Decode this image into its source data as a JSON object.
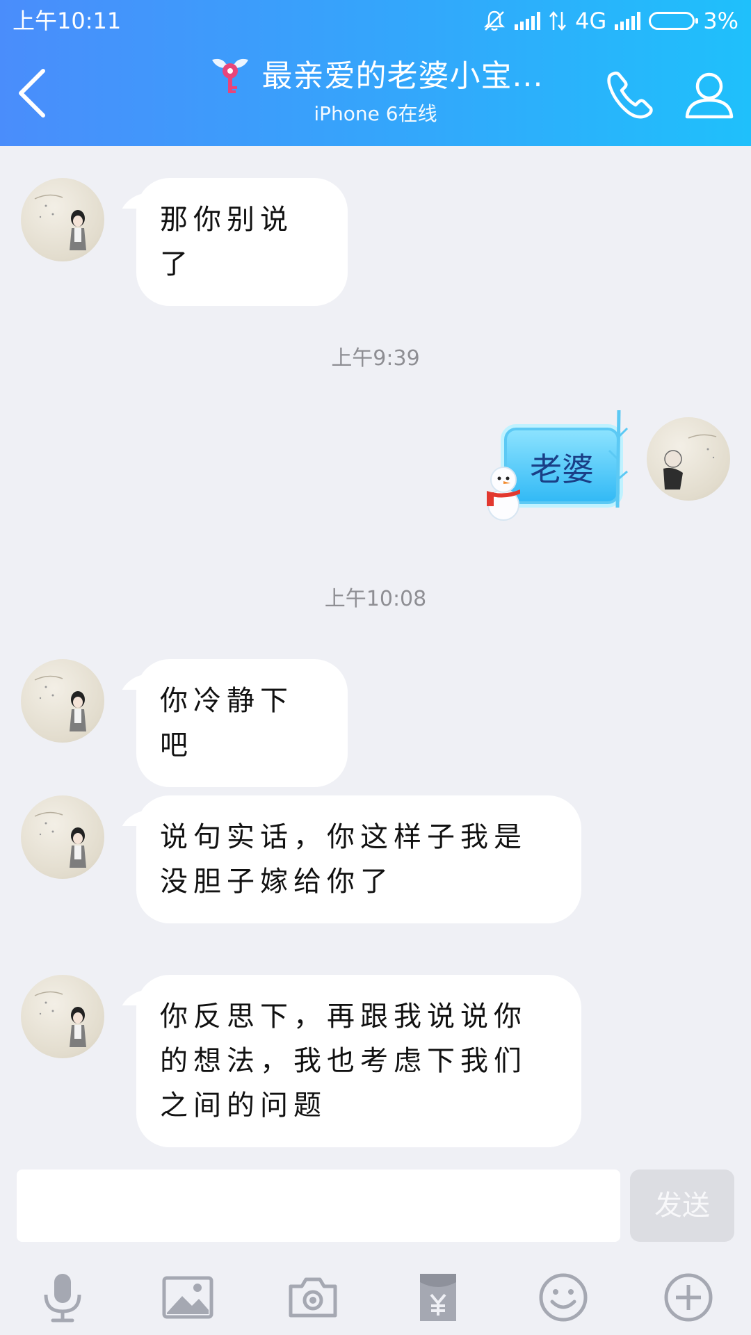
{
  "status": {
    "time": "上午10:11",
    "network": "4G",
    "battery": "3%"
  },
  "header": {
    "title": "最亲爱的老婆小宝...",
    "subtitle": "iPhone 6在线"
  },
  "timestamps": [
    "上午9:39",
    "上午10:08"
  ],
  "messages": [
    {
      "text": "那你别说了"
    },
    {
      "sticker_text": "老婆"
    },
    {
      "text": "你冷静下吧"
    },
    {
      "text": "说句实话，你这样子我是没胆子嫁给你了"
    },
    {
      "text": "你反思下，再跟我说说你的想法，我也考虑下我们之间的问题"
    }
  ],
  "input": {
    "value": "",
    "send_label": "发送"
  },
  "toolbar": {
    "icons": [
      "microphone-icon",
      "image-icon",
      "camera-icon",
      "red-packet-icon",
      "emoji-icon",
      "plus-icon"
    ]
  },
  "colors": {
    "header_start": "#4a8dfb",
    "header_end": "#1fc0fb",
    "chat_background": "#eff0f5",
    "send_disabled": "#dcdde2"
  }
}
